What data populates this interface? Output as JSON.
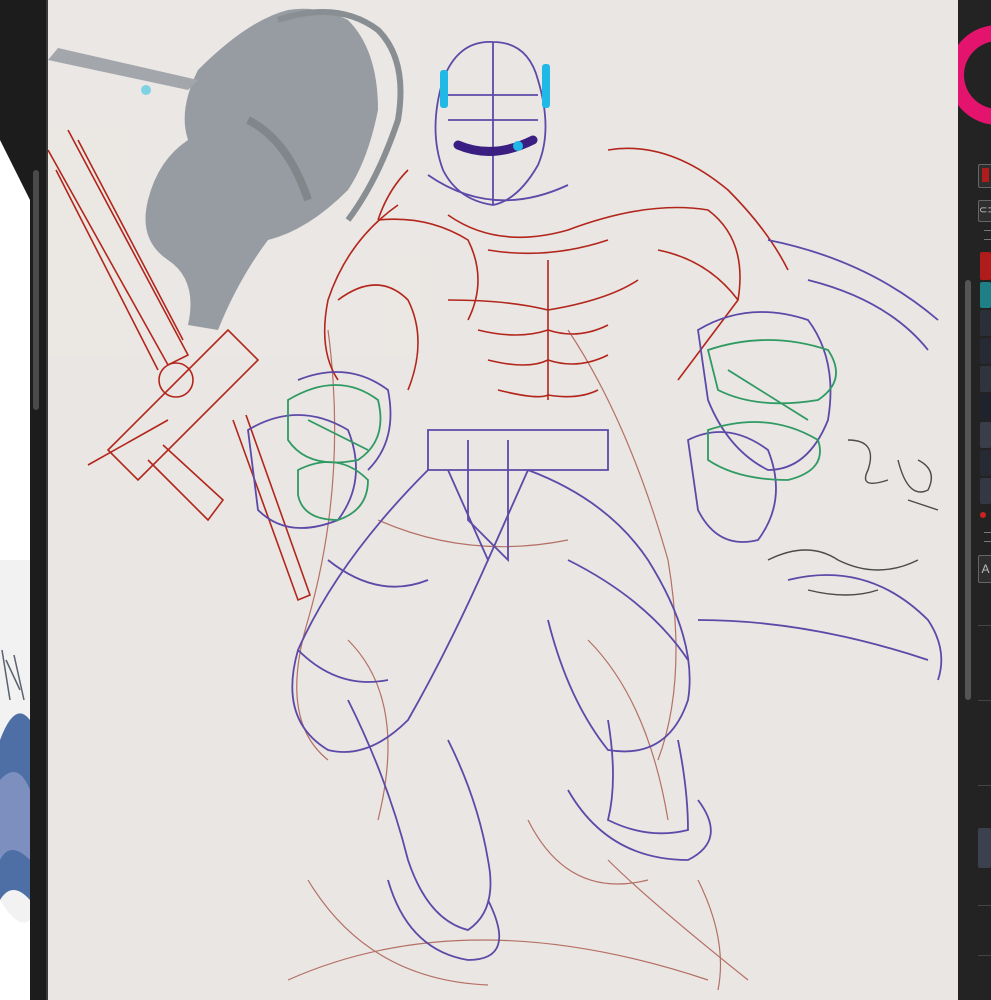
{
  "app": {
    "canvas_label": "",
    "palette": {
      "primary_color": "#b01c1c",
      "secondary_color": "#1e7f86",
      "wheel_color": "#e4146e",
      "swatches": [
        "#b01c1c",
        "#1e7f86",
        "#2a2f3a",
        "#262a34",
        "#30343f",
        "#1f232c",
        "#3a3e4a",
        "#262a33",
        "#333844",
        "#cc2222"
      ]
    },
    "sketch": {
      "line_colors": {
        "rough": "#a4493c",
        "muscle": "#b3261c",
        "armor": "#5b4aa8",
        "accent": "#2f9a62",
        "visor_glow": "#20b8e6",
        "visor_band": "#3a1e82"
      }
    },
    "icons": {
      "brush_icon": "brush-icon",
      "link_icon": "link-icon",
      "menu_icon": "menu-icon",
      "text_tool_icon": "text-tool-icon"
    }
  }
}
